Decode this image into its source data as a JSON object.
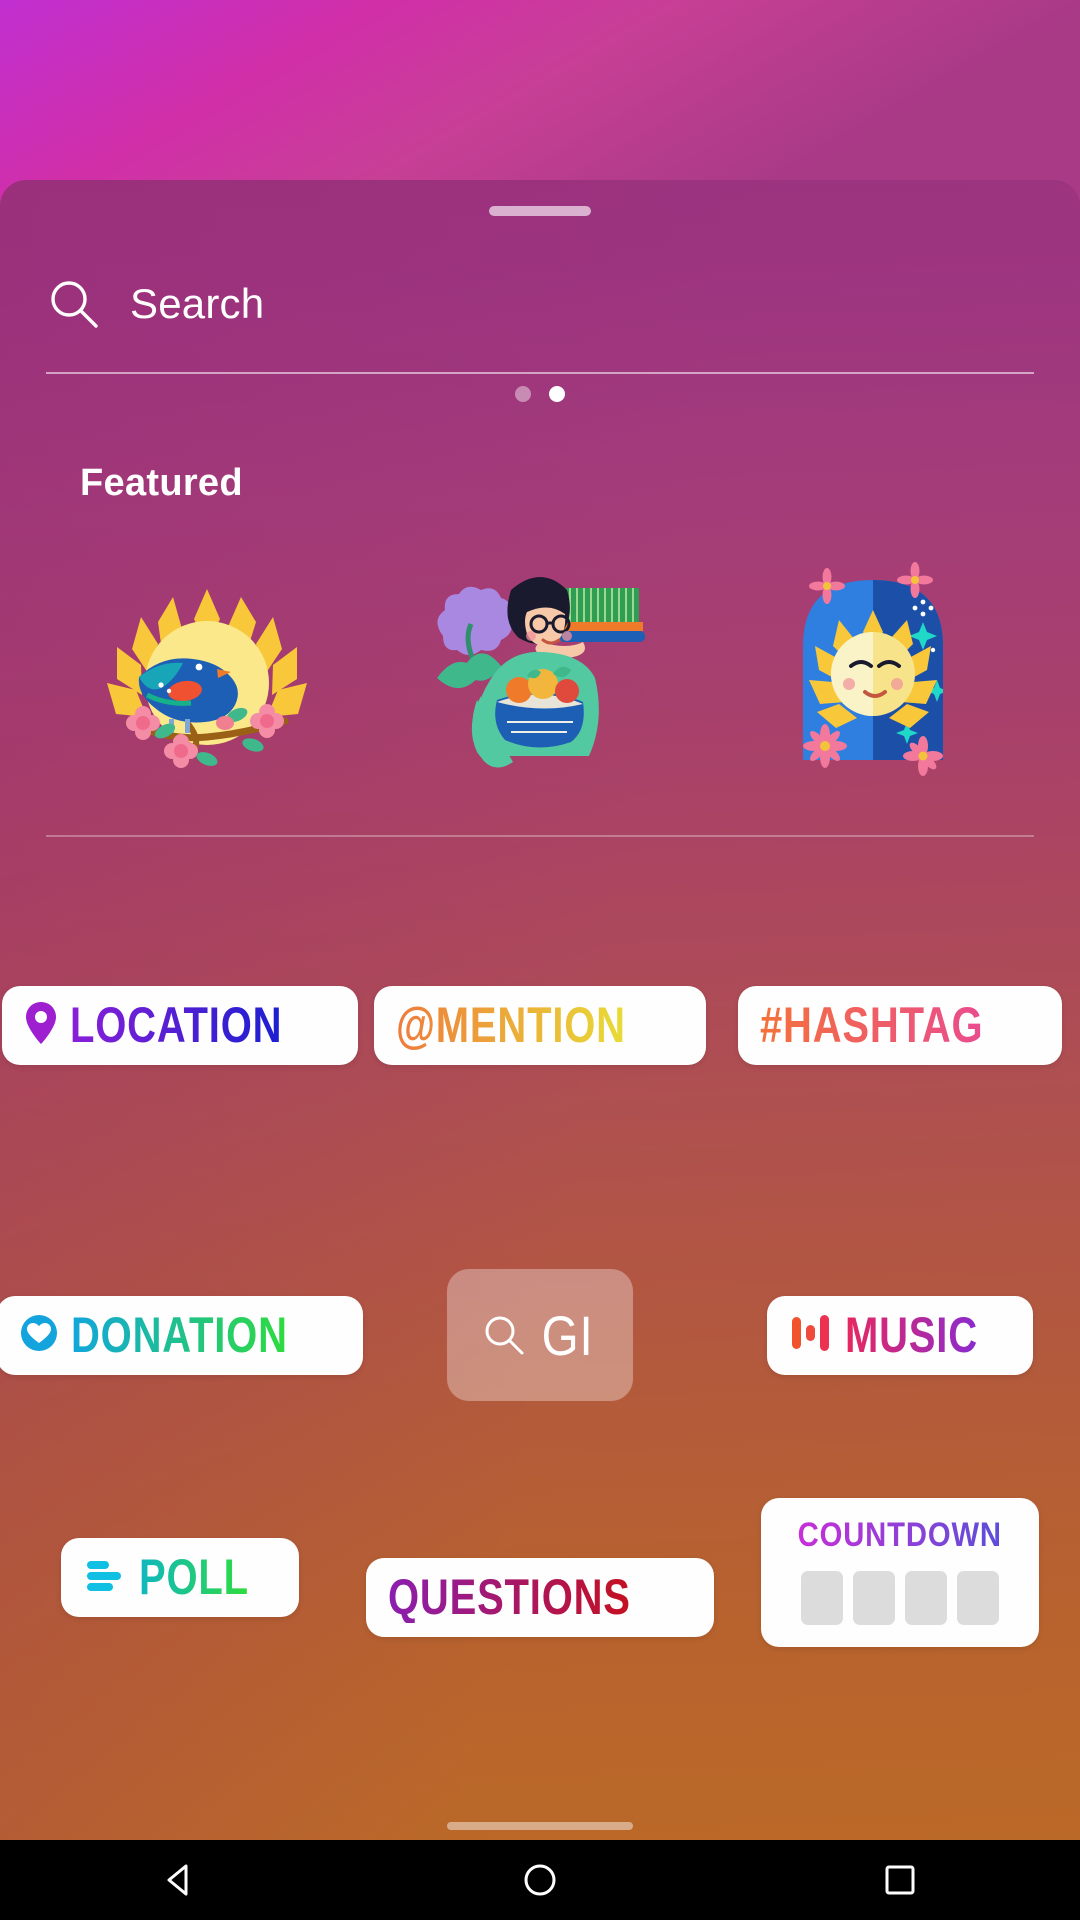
{
  "screen": {
    "app": "instagram-story-sticker-tray",
    "backdrop_gradient_from": "#c02fd0",
    "backdrop_gradient_to": "#a83a86",
    "sheet_gradient_from": "#9c3380",
    "sheet_gradient_to": "#bb6928"
  },
  "search": {
    "placeholder": "Search",
    "value": "",
    "icon": "search-icon"
  },
  "pager": {
    "total": 2,
    "active_index": 1,
    "dots": [
      {
        "active": false
      },
      {
        "active": true
      }
    ]
  },
  "featured": {
    "title": "Featured",
    "items": [
      {
        "name": "sun-bird-branch-illustration",
        "alt": "Blue bird on flowering branch in front of a yellow sun"
      },
      {
        "name": "woman-with-harvest-illustration",
        "alt": "Woman in green sweater holding a basket of produce and wheat tray"
      },
      {
        "name": "sun-moon-arch-illustration",
        "alt": "Sun and moon face inside a blue arch with pink flowers and stars"
      }
    ]
  },
  "stickers": [
    {
      "id": "location",
      "label": "LOCATION",
      "icon": "location-pin-icon",
      "icon_color": "#9d1fd0",
      "text_gradient_from": "#8a1fd8",
      "text_gradient_to": "#1b1fd0",
      "type": "pill"
    },
    {
      "id": "mention",
      "label": "@MENTION",
      "icon": null,
      "text_gradient_from": "#ee7b3c",
      "text_gradient_to": "#e8dc36",
      "type": "pill"
    },
    {
      "id": "hashtag",
      "label": "#HASHTAG",
      "icon": null,
      "text_gradient_from": "#f4713a",
      "text_gradient_to": "#ea4c8e",
      "type": "pill"
    },
    {
      "id": "donation",
      "label": "DONATION",
      "icon": "heart-in-circle-icon",
      "icon_color": "#13a3dd",
      "text_gradient_from": "#11a6dc",
      "text_gradient_to": "#2fdb3e",
      "type": "pill"
    },
    {
      "id": "gif",
      "label": "GI",
      "icon": "search-icon",
      "type": "gif-tile",
      "background": "rgba(255,255,255,0.33)"
    },
    {
      "id": "music",
      "label": "MUSIC",
      "icon": "equalizer-bars-icon",
      "icon_color": "#f0542c",
      "text_gradient_from": "#e8275f",
      "text_gradient_to": "#8a2bd0",
      "type": "pill"
    },
    {
      "id": "poll",
      "label": "POLL",
      "icon": "poll-bars-icon",
      "icon_color": "#11bfe3",
      "text_gradient_from": "#0fb7bf",
      "text_gradient_to": "#2fdb3e",
      "type": "pill"
    },
    {
      "id": "questions",
      "label": "QUESTIONS",
      "icon": null,
      "text_gradient_from": "#8a1fb0",
      "text_gradient_to": "#c41020",
      "type": "pill"
    },
    {
      "id": "countdown",
      "label": "COUNTDOWN",
      "icon": null,
      "text_gradient_from": "#c82fd8",
      "text_gradient_to": "#5b4fd8",
      "type": "countdown-card",
      "digit_boxes": 4,
      "digit_box_color": "#dcdcdc"
    }
  ],
  "navbar": {
    "background": "#000000",
    "buttons": [
      {
        "id": "back",
        "icon": "back-triangle-icon"
      },
      {
        "id": "home",
        "icon": "home-circle-icon"
      },
      {
        "id": "recents",
        "icon": "recents-square-icon"
      }
    ]
  }
}
